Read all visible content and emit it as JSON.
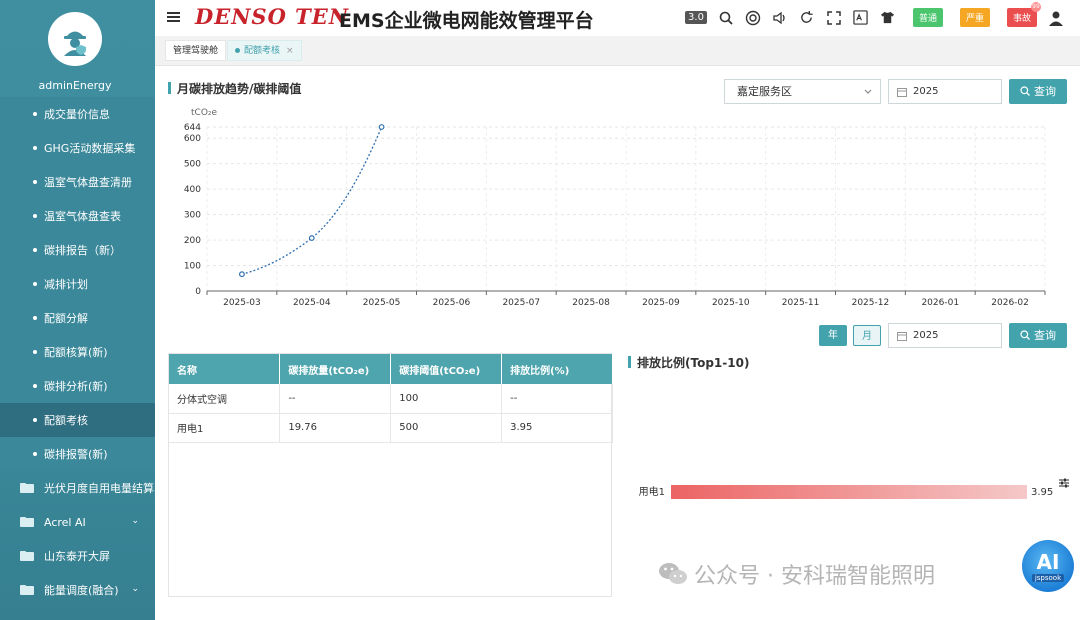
{
  "user": {
    "name": "adminEnergy"
  },
  "sidebar": {
    "items": [
      {
        "label": "成交量价信息"
      },
      {
        "label": "GHG活动数据采集"
      },
      {
        "label": "温室气体盘查清册"
      },
      {
        "label": "温室气体盘查表"
      },
      {
        "label": "碳排报告（新）"
      },
      {
        "label": "减排计划"
      },
      {
        "label": "配额分解"
      },
      {
        "label": "配额核算(新)"
      },
      {
        "label": "碳排分析(新)"
      },
      {
        "label": "配额考核"
      },
      {
        "label": "碳排报警(新)"
      }
    ],
    "groups": [
      {
        "label": "光伏月度自用电量结算单"
      },
      {
        "label": "Acrel AI"
      },
      {
        "label": "山东泰开大屏"
      },
      {
        "label": "能量调度(融合)"
      }
    ]
  },
  "header": {
    "brand": "DENSO TEN",
    "title": "EMS企业微电网能效管理平台",
    "version": "3.0",
    "badges": {
      "normal": "普通",
      "serious": "严重",
      "accident": "事故",
      "accident_count": "99"
    }
  },
  "tabs": [
    {
      "label": "管理驾驶舱"
    },
    {
      "label": "配额考核",
      "close": "×"
    }
  ],
  "trend": {
    "title": "月碳排放趋势/碳排阈值",
    "area_select": "嘉定服务区",
    "year": "2025",
    "query": "查询"
  },
  "ratio": {
    "title": "排放比例(Top1-10)",
    "year_btn": "年",
    "month_btn": "月",
    "year": "2025",
    "query": "查询"
  },
  "table": {
    "headers": [
      "名称",
      "碳排放量(tCO₂e)",
      "碳排阈值(tCO₂e)",
      "排放比例(%)"
    ],
    "rows": [
      [
        "分体式空调",
        "--",
        "100",
        "--"
      ],
      [
        "用电1",
        "19.76",
        "500",
        "3.95"
      ]
    ]
  },
  "chart_data": [
    {
      "type": "line",
      "ylabel": "tCO₂e",
      "x": [
        "2025-03",
        "2025-04",
        "2025-05",
        "2025-06",
        "2025-07",
        "2025-08",
        "2025-09",
        "2025-10",
        "2025-11",
        "2025-12",
        "2026-01",
        "2026-02"
      ],
      "series": [
        {
          "values": [
            66,
            208,
            644,
            null,
            null,
            null,
            null,
            null,
            null,
            null,
            null,
            null
          ]
        }
      ],
      "yticks": [
        0,
        100,
        200,
        300,
        400,
        500,
        600,
        644
      ],
      "ylim": [
        0,
        644
      ],
      "grid": true
    },
    {
      "type": "bar",
      "categories": [
        "用电1"
      ],
      "values": [
        3.95
      ],
      "orientation": "horizontal"
    }
  ],
  "watermark": "公众号 · 安科瑞智能照明",
  "ai_logo": {
    "big": "AI",
    "small": "jspsook"
  },
  "colors": {
    "accent": "#42a3ad",
    "brand": "#c8222a",
    "bar_start": "#ec6464",
    "bar_end": "#f5c8c8"
  }
}
